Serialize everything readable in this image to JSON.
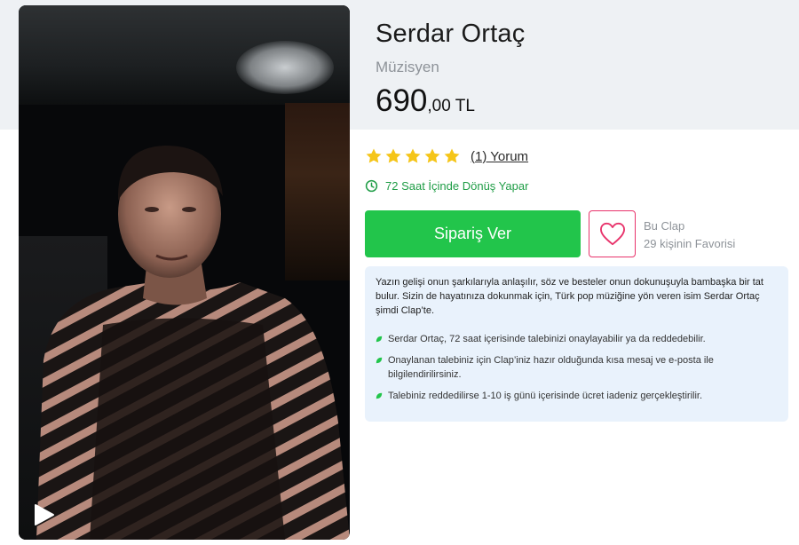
{
  "product": {
    "name": "Serdar Ortaç",
    "category": "Müzisyen",
    "price_integer": "690",
    "price_decimal": ",00 TL"
  },
  "rating": {
    "stars": 5,
    "max_stars": 5,
    "review_link": "(1) Yorum"
  },
  "delivery": {
    "text": "72 Saat İçinde Dönüş Yapar"
  },
  "actions": {
    "order_label": "Sipariş Ver",
    "favorite_caption": "Bu Clap",
    "favorite_count_text": "29 kişinin Favorisi"
  },
  "info": {
    "intro": "Yazın gelişi onun şarkılarıyla anlaşılır, söz ve besteler onun dokunuşuyla bambaşka bir tat bulur. Sizin de hayatınıza dokunmak için, Türk pop müziğine yön veren isim Serdar Ortaç şimdi Clap’te.",
    "items": [
      "Serdar Ortaç, 72 saat içerisinde talebinizi onaylayabilir ya da reddedebilir.",
      "Onaylanan talebiniz için Clap’iniz hazır olduğunda kısa mesaj ve e-posta ile bilgilendirilirsiniz.",
      "Talebiniz reddedilirse 1-10 iş günü içerisinde ücret iadeniz gerçekleştirilir."
    ]
  },
  "icons": {
    "star": "star-icon",
    "clock": "clock-icon",
    "heart": "heart-icon",
    "play": "play-icon",
    "leaf_bullet": "leaf-icon"
  },
  "colors": {
    "accent_green": "#22c54b",
    "delivery_green": "#1f9d46",
    "star_yellow": "#f5c518",
    "favorite_pink": "#e8336b",
    "info_bg": "#e9f2fc",
    "header_bg": "#eef1f4"
  }
}
